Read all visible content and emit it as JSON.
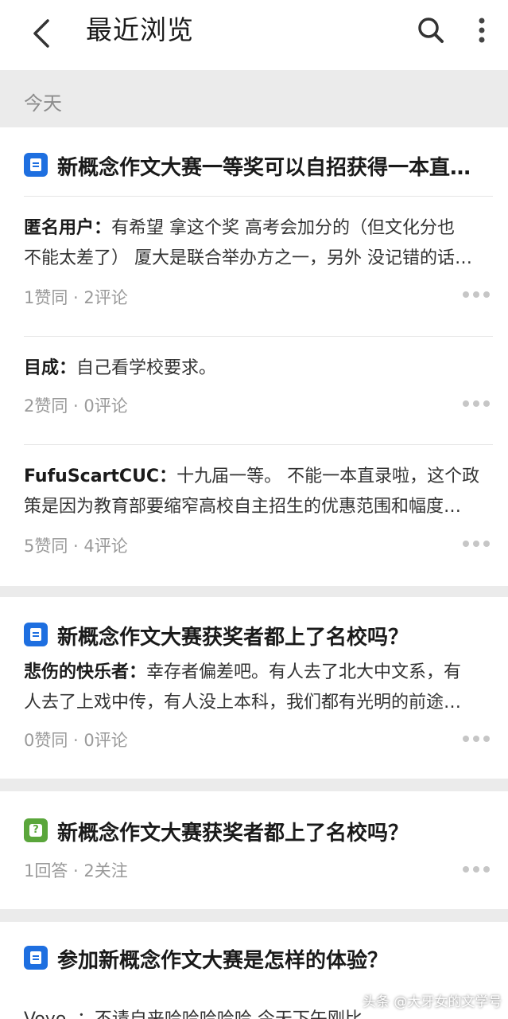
{
  "header": {
    "title": "最近浏览",
    "back_icon": "back-arrow-icon",
    "search_icon": "search-icon",
    "more_icon": "more-vertical-icon"
  },
  "section": {
    "label": "今天"
  },
  "cards": [
    {
      "title": "新概念作文大赛一等奖可以自招获得一本直…",
      "answers": [
        {
          "author": "匿名用户：",
          "line1": "有希望 拿这个奖 高考会加分的（但文化分也",
          "line2": "不能太差了） 厦大是联合举办方之一，另外 没记错的话…",
          "meta": "1赞同 · 2评论"
        },
        {
          "author": "目成：",
          "line1": "自己看学校要求。",
          "line2": "",
          "meta": "2赞同 · 0评论"
        },
        {
          "author": "FufuScartCUC：",
          "line1": "十九届一等。 不能一本直录啦，这个政",
          "line2": "策是因为教育部要缩窄高校自主招生的优惠范围和幅度…",
          "meta": "5赞同 · 4评论"
        }
      ]
    },
    {
      "title": "新概念作文大赛获奖者都上了名校吗？",
      "answers": [
        {
          "author": "悲伤的快乐者：",
          "line1": "幸存者偏差吧。有人去了北大中文系，有",
          "line2": "人去了上戏中传，有人没上本科，我们都有光明的前途…",
          "meta": "0赞同 · 0评论"
        }
      ]
    },
    {
      "title": "新概念作文大赛获奖者都上了名校吗？",
      "meta": "1回答 · 2关注"
    },
    {
      "title": "参加新概念作文大赛是怎样的体验？",
      "partial": "Voyo..：不请自来哈哈哈哈哈 今天下午刚比"
    }
  ],
  "watermark": "头条 @大牙女的文学号",
  "colors": {
    "accent_blue": "#1e6fe0",
    "question_green": "#5aa63b",
    "muted_text": "#9a9a9a",
    "background": "#ebebeb"
  }
}
